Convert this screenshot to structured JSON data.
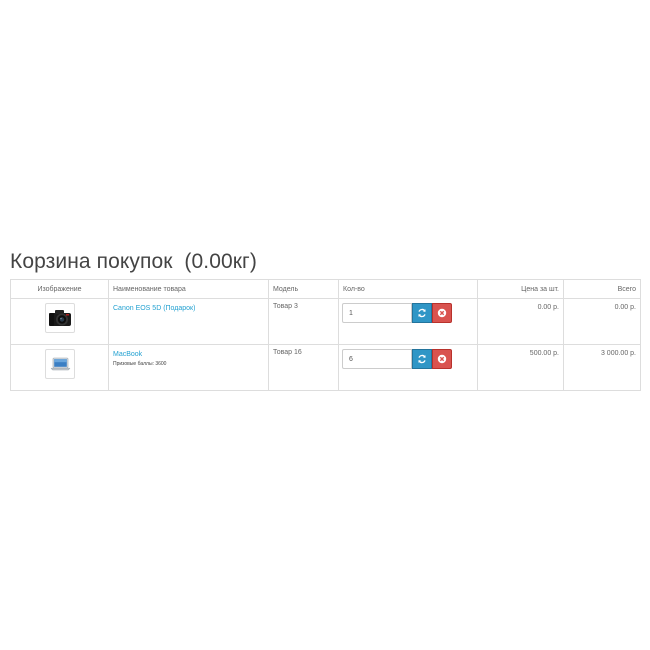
{
  "cart": {
    "title": "Корзина покупок  (0.00кг)"
  },
  "table": {
    "headers": {
      "image": "Изображение",
      "name": "Наименование товара",
      "model": "Модель",
      "quantity": "Кол-во",
      "unit_price": "Цена за шт.",
      "total": "Всего"
    },
    "rows": [
      {
        "image_icon": "camera-icon",
        "name": "Canon EOS 5D (Подарок)",
        "note": "",
        "model": "Товар 3",
        "quantity": "1",
        "unit_price": "0.00 р.",
        "total": "0.00 р."
      },
      {
        "image_icon": "laptop-icon",
        "name": "MacBook",
        "note": "Призовые баллы: 3600",
        "model": "Товар 16",
        "quantity": "6",
        "unit_price": "500.00 р.",
        "total": "3 000.00 р."
      }
    ]
  },
  "icons": {
    "refresh": "refresh-icon",
    "remove": "remove-icon"
  },
  "colors": {
    "link": "#23a1d1",
    "refresh_button": "#2f96c6",
    "remove_button": "#d9534f",
    "border": "#dddddd"
  }
}
